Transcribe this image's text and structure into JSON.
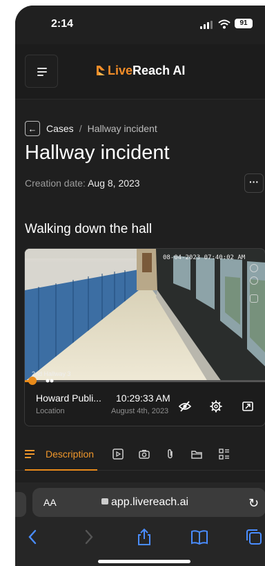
{
  "status_bar": {
    "time": "2:14",
    "battery": "91"
  },
  "header": {
    "brand_prefix": "Live",
    "brand_suffix": "Reach AI"
  },
  "breadcrumb": {
    "parent": "Cases",
    "separator": "/",
    "current": "Hallway incident"
  },
  "page": {
    "title": "Hallway incident",
    "creation_label": "Creation date:",
    "creation_date": "Aug 8, 2023",
    "more_label": "···"
  },
  "section": {
    "title": "Walking down the hall"
  },
  "video": {
    "timestamp_overlay": "08-04-2023 07:40:02 AM",
    "camera_label": "2nd Hallway 3",
    "progress": 0.03,
    "location_name": "Howard Publi...",
    "location_label": "Location",
    "time": "10:29:33 AM",
    "date": "August 4th, 2023",
    "controls": [
      "hide-icon",
      "settings-icon",
      "fullscreen-icon"
    ]
  },
  "tabs": {
    "active_label": "Description",
    "icons": [
      "video-icon",
      "camera-icon",
      "paperclip-icon",
      "folder-icon",
      "checklist-icon"
    ]
  },
  "browser": {
    "text_size": "AA",
    "url": "app.livereach.ai",
    "nav": [
      "back-icon",
      "forward-icon",
      "share-icon",
      "bookmarks-icon",
      "tabs-icon"
    ]
  },
  "colors": {
    "accent": "#e88a1a",
    "background": "#1f1f1f"
  }
}
